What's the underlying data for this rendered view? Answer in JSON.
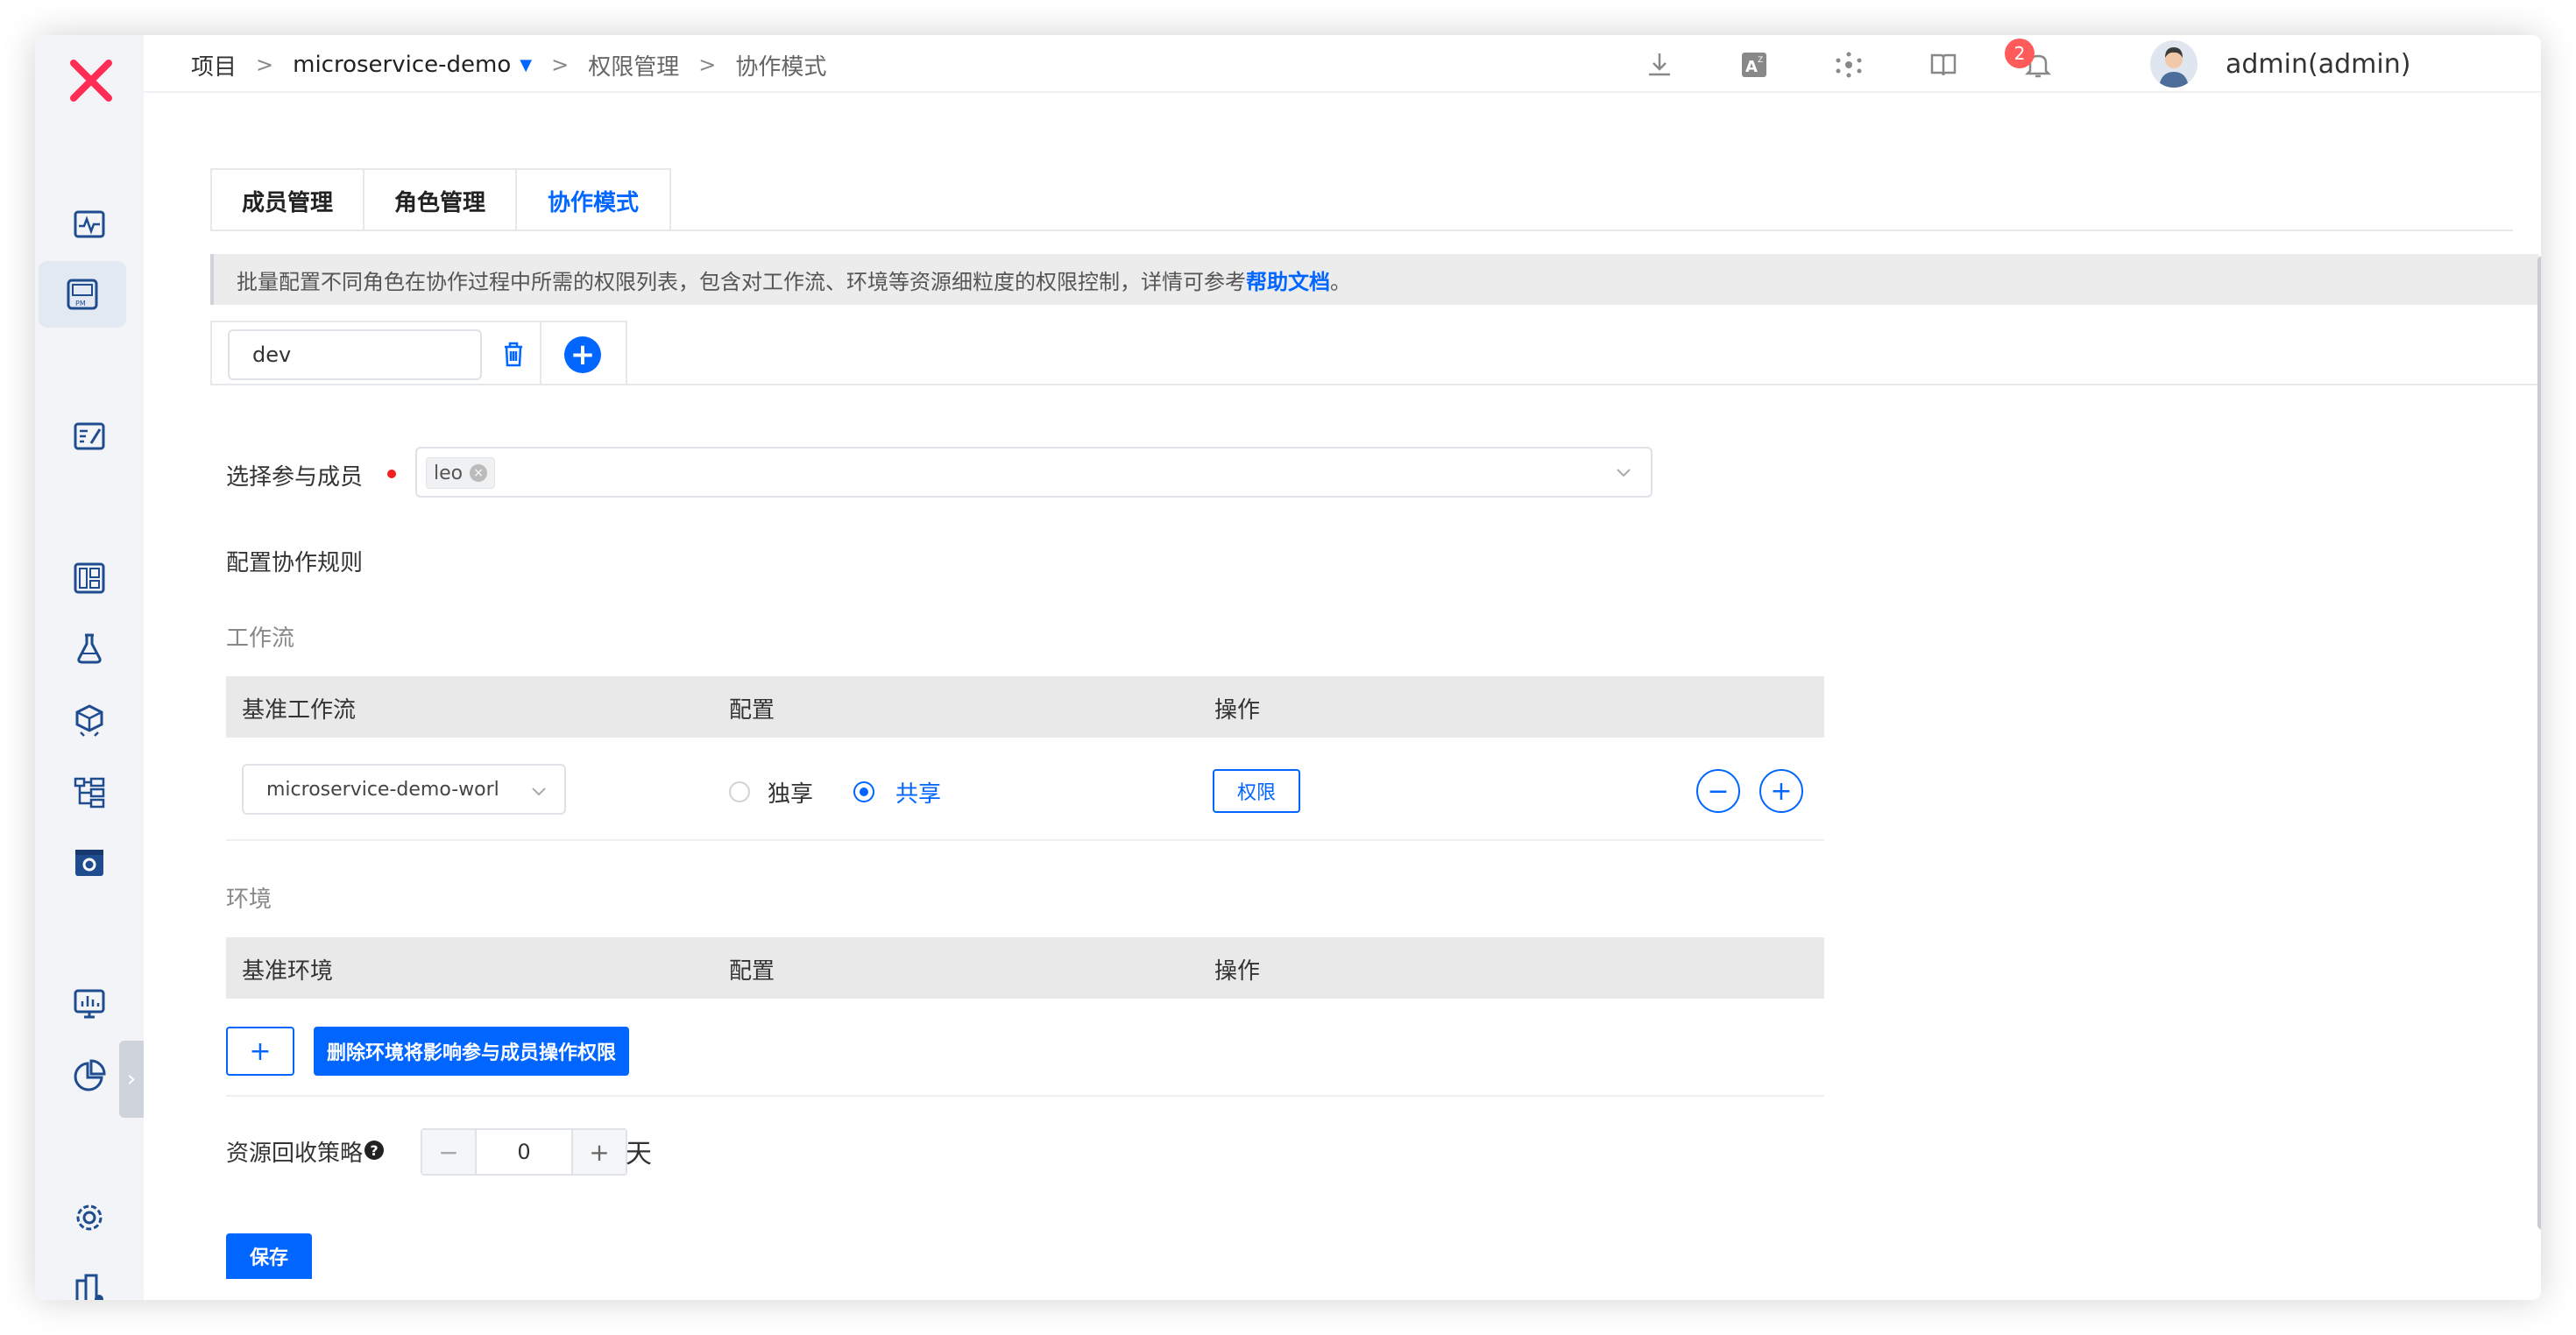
{
  "breadcrumb": {
    "root": "项目",
    "project": "microservice-demo",
    "section": "权限管理",
    "current": "协作模式"
  },
  "user": {
    "name": "admin(admin)"
  },
  "notifications": {
    "count": "2"
  },
  "tabs": [
    {
      "label": "成员管理"
    },
    {
      "label": "角色管理"
    },
    {
      "label": "协作模式"
    }
  ],
  "info": {
    "text": "批量配置不同角色在协作过程中所需的权限列表，包含对工作流、环境等资源细粒度的权限控制，详情可参考",
    "link": "帮助文档",
    "suffix": "。"
  },
  "group": {
    "name": "dev"
  },
  "members": {
    "label": "选择参与成员",
    "tags": [
      "leo"
    ]
  },
  "rules": {
    "label": "配置协作规则"
  },
  "workflow": {
    "section": "工作流",
    "headers": [
      "基准工作流",
      "配置",
      "操作"
    ],
    "row": {
      "workflow": "microservice-demo-worl",
      "option_exclusive": "独享",
      "option_shared": "共享",
      "selected": "共享",
      "perm_button": "权限"
    }
  },
  "environment": {
    "section": "环境",
    "headers": [
      "基准环境",
      "配置",
      "操作"
    ],
    "add_button": "+",
    "warn_button": "删除环境将影响参与成员操作权限"
  },
  "recycle": {
    "label": "资源回收策略",
    "value": "0",
    "unit": "天"
  },
  "save_label": "保存",
  "colors": {
    "accent": "#0066ff",
    "logo": "#ff2d55",
    "badge": "#ff5b5b"
  }
}
